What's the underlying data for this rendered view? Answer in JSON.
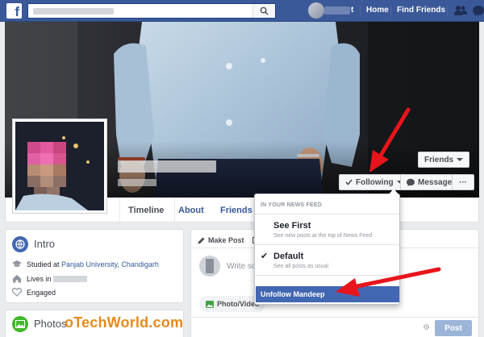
{
  "topbar": {
    "logo": "f",
    "search": {
      "value": "",
      "placeholder": ""
    },
    "nav": {
      "home": "Home",
      "find_friends": "Find Friends"
    },
    "profile_name_partial": "t"
  },
  "profile": {
    "buttons": {
      "friends": "Friends",
      "following": "Following",
      "message": "Message",
      "more": "···"
    }
  },
  "tabs": {
    "timeline": "Timeline",
    "about": "About",
    "friends": "Friends"
  },
  "intro": {
    "title": "Intro",
    "studied_prefix": "Studied at ",
    "studied_link": "Panjab University, Chandigarh",
    "lives_prefix": "Lives in ",
    "relationship": "Engaged"
  },
  "photos": {
    "title": "Photos"
  },
  "composer": {
    "make_post": "Make Post",
    "placeholder": "Write so",
    "photo_video": "Photo/Video",
    "post": "Post"
  },
  "dropdown": {
    "header": "IN YOUR NEWS FEED",
    "see_first": {
      "title": "See First",
      "subtitle": "See new posts at the top of News Feed"
    },
    "default": {
      "title": "Default",
      "subtitle": "See all posts as usual",
      "checked": true
    },
    "unfollow": "Unfollow Mandeep"
  },
  "watermark": "oTechWorld.com",
  "colors": {
    "topbar": "#3b5998",
    "highlight": "#4267b2",
    "arrow": "#e8141c",
    "watermark": "#e8891c"
  }
}
